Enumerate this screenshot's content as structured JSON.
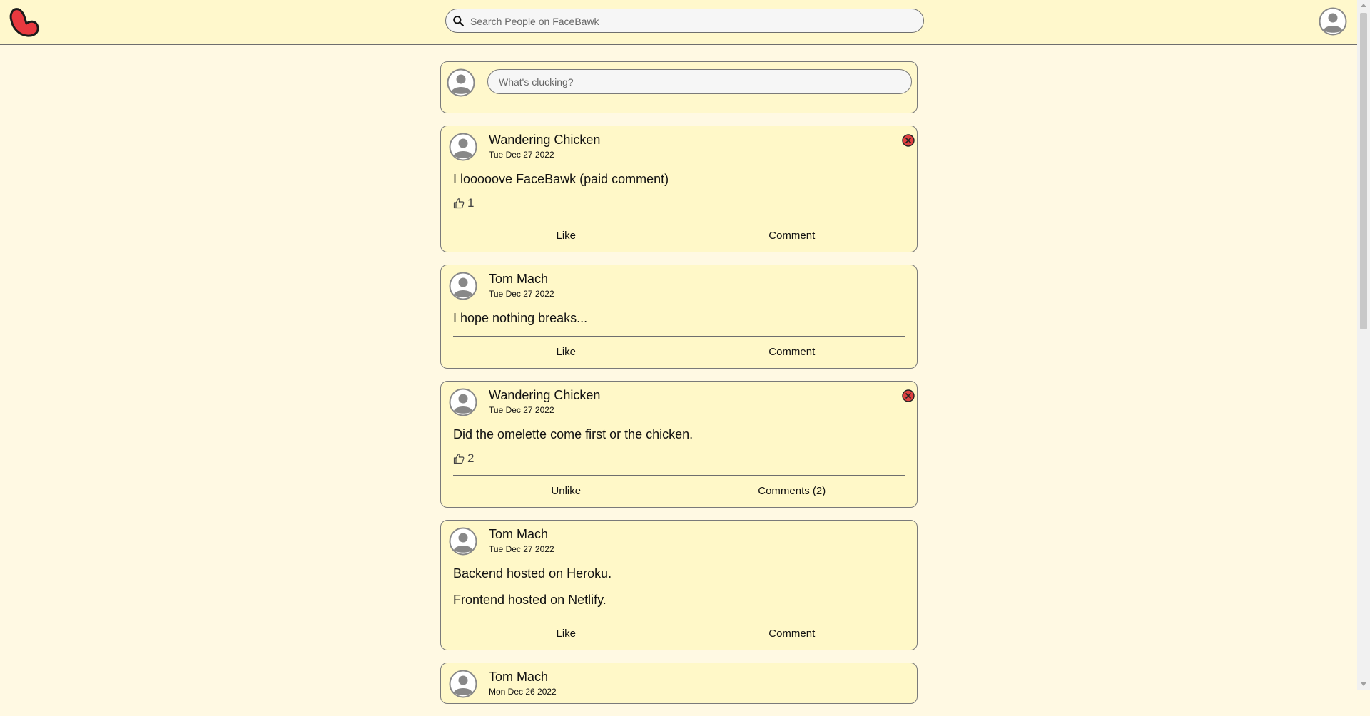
{
  "header": {
    "search_placeholder": "Search People on FaceBawk"
  },
  "composer": {
    "placeholder": "What's clucking?"
  },
  "posts": [
    {
      "author": "Wandering Chicken",
      "date": "Tue Dec 27 2022",
      "lines": [
        "I looooove FaceBawk (paid comment)"
      ],
      "likes": "1",
      "deletable": true,
      "like_label": "Like",
      "comment_label": "Comment"
    },
    {
      "author": "Tom Mach",
      "date": "Tue Dec 27 2022",
      "lines": [
        "I hope nothing breaks..."
      ],
      "likes": null,
      "deletable": false,
      "like_label": "Like",
      "comment_label": "Comment"
    },
    {
      "author": "Wandering Chicken",
      "date": "Tue Dec 27 2022",
      "lines": [
        "Did the omelette come first or the chicken."
      ],
      "likes": "2",
      "deletable": true,
      "like_label": "Unlike",
      "comment_label": "Comments (2)"
    },
    {
      "author": "Tom Mach",
      "date": "Tue Dec 27 2022",
      "lines": [
        "Backend hosted on Heroku.",
        "Frontend hosted on Netlify."
      ],
      "likes": null,
      "deletable": false,
      "like_label": "Like",
      "comment_label": "Comment"
    },
    {
      "author": "Tom Mach",
      "date": "Mon Dec 26 2022",
      "lines": [],
      "likes": null,
      "deletable": false,
      "like_label": "",
      "comment_label": ""
    }
  ],
  "colors": {
    "page_bg": "#fff9e3",
    "card_bg": "#fff8c8",
    "logo_red": "#e8393f",
    "delete_red": "#e04040"
  }
}
